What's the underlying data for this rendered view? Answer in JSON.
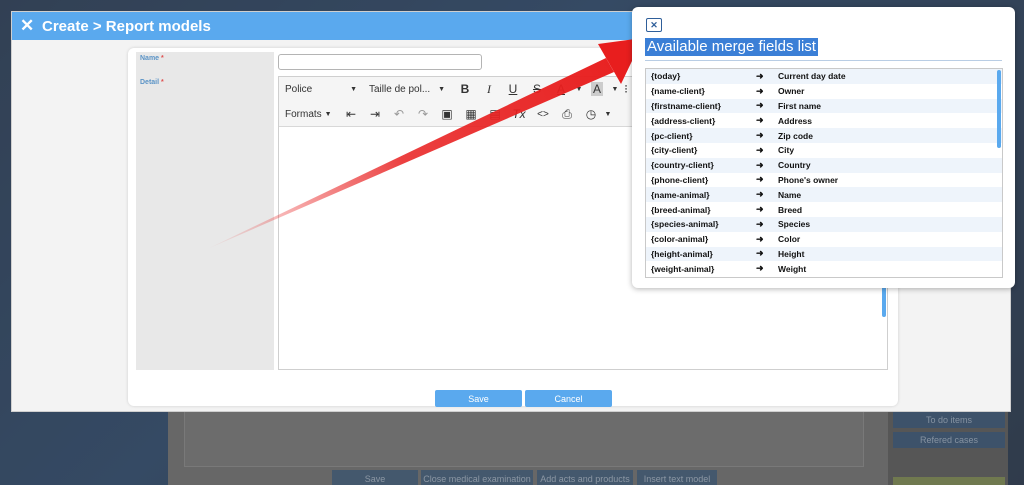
{
  "background": {
    "bottom_buttons": [
      "Save",
      "Close medical examination",
      "Add acts and products",
      "Insert text model"
    ],
    "right_buttons": [
      "To do items",
      "Refered cases"
    ]
  },
  "dialog": {
    "title": "Create > Report models",
    "name_label": "Name",
    "detail_label": "Detail",
    "required_mark": "*",
    "toolbar": {
      "font_family": "Police",
      "font_size": "Taille de pol...",
      "formats": "Formats"
    },
    "save_label": "Save",
    "cancel_label": "Cancel"
  },
  "popup": {
    "title": "Available merge fields list",
    "close_glyph": "✕",
    "fields": [
      {
        "code": "{today}",
        "desc": "Current day date"
      },
      {
        "code": "{name-client}",
        "desc": "Owner"
      },
      {
        "code": "{firstname-client}",
        "desc": "First name"
      },
      {
        "code": "{address-client}",
        "desc": "Address"
      },
      {
        "code": "{pc-client}",
        "desc": "Zip code"
      },
      {
        "code": "{city-client}",
        "desc": "City"
      },
      {
        "code": "{country-client}",
        "desc": "Country"
      },
      {
        "code": "{phone-client}",
        "desc": "Phone's owner"
      },
      {
        "code": "{name-animal}",
        "desc": "Name"
      },
      {
        "code": "{breed-animal}",
        "desc": "Breed"
      },
      {
        "code": "{species-animal}",
        "desc": "Species"
      },
      {
        "code": "{color-animal}",
        "desc": "Color"
      },
      {
        "code": "{height-animal}",
        "desc": "Height"
      },
      {
        "code": "{weight-animal}",
        "desc": "Weight"
      }
    ]
  },
  "colors": {
    "accent": "#5aa9ee",
    "required": "#e05050",
    "title_highlight": "#3b7fd6",
    "arrow": "#e81e1e"
  }
}
